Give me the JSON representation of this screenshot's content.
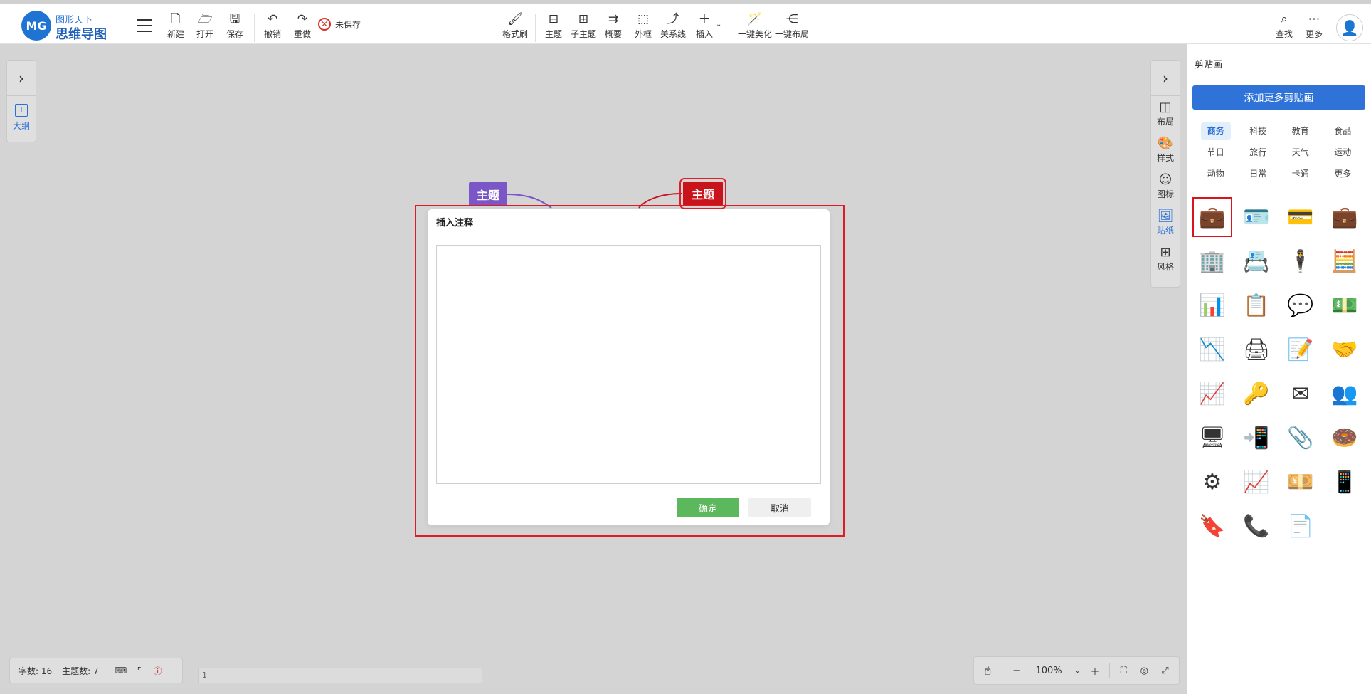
{
  "app": {
    "logo_mark": "MG",
    "logo_line1": "图形天下",
    "logo_line2": "思维导图"
  },
  "toolbar": {
    "new": "新建",
    "open": "打开",
    "save": "保存",
    "undo": "撤销",
    "redo": "重做",
    "unsaved": "未保存",
    "format_painter": "格式刷",
    "topic": "主题",
    "subtopic": "子主题",
    "summary": "概要",
    "boundary": "外框",
    "relation": "关系线",
    "insert": "插入",
    "beautify": "一键美化",
    "auto_layout": "一键布局",
    "find": "查找",
    "more": "更多"
  },
  "left_panel": {
    "outline": "大纲"
  },
  "right_strip": {
    "layout": "布局",
    "style": "样式",
    "icon": "图标",
    "sticker": "贴纸",
    "theme": "风格"
  },
  "canvas": {
    "node_purple": "主题",
    "node_red": "主题",
    "colors": {
      "purple": "#7a56c6",
      "red": "#c9141b"
    }
  },
  "modal": {
    "title": "插入注释",
    "note_value": "",
    "confirm": "确定",
    "cancel": "取消"
  },
  "status": {
    "word_count": "字数: 16",
    "topic_count": "主题数: 7",
    "page_value": "1"
  },
  "zoom": {
    "value": "100%"
  },
  "sidebar": {
    "title": "剪贴画",
    "add_more": "添加更多剪贴画",
    "categories": [
      "商务",
      "科技",
      "教育",
      "食品",
      "节日",
      "旅行",
      "天气",
      "运动",
      "动物",
      "日常",
      "卡通",
      "更多"
    ],
    "active_category": "商务",
    "clips": [
      {
        "name": "briefcase-clock-icon",
        "glyph": "💼"
      },
      {
        "name": "id-card-icon",
        "glyph": "🪪"
      },
      {
        "name": "credit-cards-icon",
        "glyph": "💳"
      },
      {
        "name": "briefcase-icon",
        "glyph": "💼"
      },
      {
        "name": "office-building-icon",
        "glyph": "🏢"
      },
      {
        "name": "business-card-icon",
        "glyph": "📇"
      },
      {
        "name": "businessman-icon",
        "glyph": "🕴"
      },
      {
        "name": "calculator-icon",
        "glyph": "🧮"
      },
      {
        "name": "candlestick-chart-icon",
        "glyph": "📊"
      },
      {
        "name": "resume-clipboard-icon",
        "glyph": "📋"
      },
      {
        "name": "chat-bubbles-icon",
        "glyph": "💬"
      },
      {
        "name": "money-stack-icon",
        "glyph": "💵"
      },
      {
        "name": "declining-chart-icon",
        "glyph": "📉"
      },
      {
        "name": "printer-icon",
        "glyph": "🖨"
      },
      {
        "name": "clipboard-icon",
        "glyph": "📝"
      },
      {
        "name": "handshake-icon",
        "glyph": "🤝"
      },
      {
        "name": "growth-chart-icon",
        "glyph": "📈"
      },
      {
        "name": "key-icon",
        "glyph": "🔑"
      },
      {
        "name": "envelope-icon",
        "glyph": "✉"
      },
      {
        "name": "team-icon",
        "glyph": "👥"
      },
      {
        "name": "video-call-icon",
        "glyph": "🖥"
      },
      {
        "name": "mobile-payment-icon",
        "glyph": "📲"
      },
      {
        "name": "paperclip-icon",
        "glyph": "📎"
      },
      {
        "name": "pie-percent-icon",
        "glyph": "🍩"
      },
      {
        "name": "gear-flower-icon",
        "glyph": "⚙"
      },
      {
        "name": "trend-axis-icon",
        "glyph": "📈"
      },
      {
        "name": "cash-bundle-icon",
        "glyph": "💴"
      },
      {
        "name": "phone-qr-icon",
        "glyph": "📱"
      },
      {
        "name": "stamp-icon",
        "glyph": "🔖"
      },
      {
        "name": "phone-call-icon",
        "glyph": "📞"
      },
      {
        "name": "document-check-icon",
        "glyph": "📄"
      }
    ]
  }
}
